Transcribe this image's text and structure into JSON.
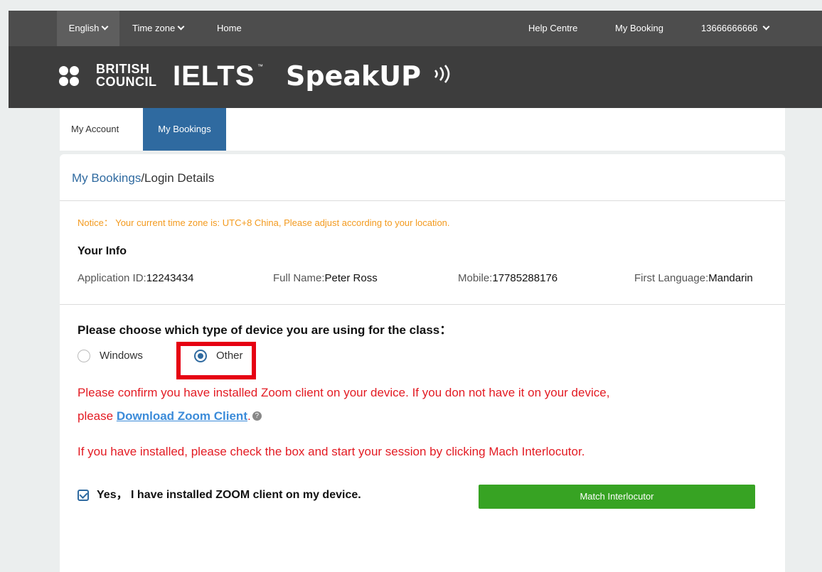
{
  "topnav": {
    "language": "English",
    "timezone": "Time zone",
    "home": "Home",
    "help": "Help Centre",
    "my_booking": "My Booking",
    "account_phone": "13666666666"
  },
  "brand": {
    "council_line1": "BRITISH",
    "council_line2": "COUNCIL",
    "ielts": "IELTS",
    "speakup": "SpeakUP"
  },
  "tabs": {
    "account": "My Account",
    "bookings": "My Bookings"
  },
  "breadcrumb": {
    "link": "My Bookings",
    "current": "/Login Details"
  },
  "notice": "Notice： Your current time zone is: UTC+8 China, Please adjust according to your location.",
  "info": {
    "heading": "Your Info",
    "application_label": "Application ID:",
    "application_value": "12243434",
    "name_label": "Full Name:",
    "name_value": "Peter Ross",
    "mobile_label": "Mobile:",
    "mobile_value": "17785288176",
    "language_label": "First Language:",
    "language_value": "Mandarin"
  },
  "device": {
    "question": "Please choose which type of device you are using for the class：",
    "option_windows": "Windows",
    "option_other": "Other",
    "selected": "Other"
  },
  "warnings": {
    "line1": "Please confirm you have installed Zoom client on your device. If you don not have it on your device,",
    "line2_prefix": "please ",
    "download_link": "Download Zoom Client",
    "line2_suffix": ".",
    "help_glyph": "?",
    "line3": "If you have installed, please check the box and start your session by clicking Mach Interlocutor."
  },
  "confirm": {
    "label": "Yes， I have installed ZOOM client on my device.",
    "checked": true
  },
  "button": {
    "match": "Match Interlocutor"
  },
  "colors": {
    "topbar": "#4d4d4d",
    "brandbar": "#3d3d3d",
    "tab_active": "#2f6aa0",
    "notice": "#f39a1e",
    "warning": "#e31b23",
    "link": "#3b8bd9",
    "button": "#37a323",
    "highlight_box": "#e60012"
  }
}
